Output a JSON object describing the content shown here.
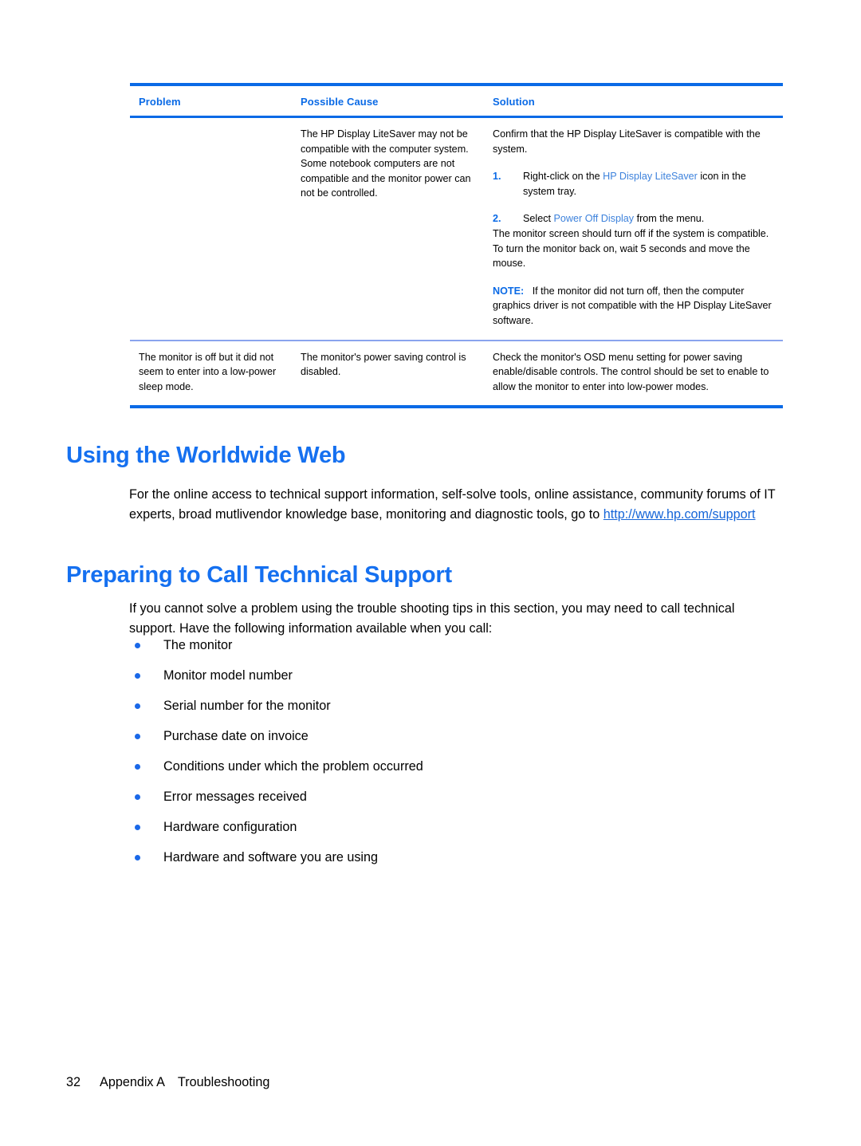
{
  "document": {
    "page_number": "32",
    "appendix": "Appendix A",
    "chapter": "Troubleshooting"
  },
  "colors": {
    "heading_blue": "#1570f0",
    "rule_blue": "#0a6ae6",
    "row_rule_blue": "#8aa4ee",
    "inline_blue": "#3d82dc",
    "link_blue": "#1565d8",
    "bullet_blue": "#1a68e8"
  },
  "table": {
    "headers": {
      "problem": "Problem",
      "possible_cause": "Possible Cause",
      "solution": "Solution"
    },
    "rows": [
      {
        "problem": "",
        "possible_cause": "The HP Display LiteSaver may not be compatible with the computer system. Some notebook computers are not compatible and the monitor power can not be controlled.",
        "solution": {
          "intro": "Confirm that the HP Display LiteSaver is compatible with the system.",
          "steps": [
            {
              "number": "1.",
              "before": "Right-click on the ",
              "highlight": "HP Display LiteSaver",
              "after": " icon in the system tray."
            },
            {
              "number": "2.",
              "before": "Select ",
              "highlight": "Power Off Display",
              "after": " from the menu."
            }
          ],
          "after_steps": "The monitor screen should turn off if the system is compatible. To turn the monitor back on, wait 5 seconds and move the mouse.",
          "note_label": "NOTE:",
          "note_text": "If the monitor did not turn off, then the computer graphics driver is not compatible with the HP Display LiteSaver software."
        }
      },
      {
        "problem": "The monitor is off but it did not seem to enter into a low-power sleep mode.",
        "possible_cause": "The monitor's power saving control is disabled.",
        "solution_text": "Check the monitor's OSD menu setting for power saving enable/disable controls. The control should be set to enable to allow the monitor to enter into low-power modes."
      }
    ]
  },
  "sections": [
    {
      "heading": "Using the Worldwide Web",
      "paragraph_before_link": "For the online access to technical support information, self-solve tools, online assistance, community forums of IT experts, broad mutlivendor knowledge base, monitoring and diagnostic tools, go to ",
      "link_text": "http://www.hp.com/support"
    },
    {
      "heading": "Preparing to Call Technical Support",
      "paragraph": "If you cannot solve a problem using the trouble shooting tips in this section, you may need to call technical support. Have the following information available when you call:"
    }
  ],
  "bullets": [
    "The monitor",
    "Monitor model number",
    "Serial number for the monitor",
    "Purchase date on invoice",
    "Conditions under which the problem occurred",
    "Error messages received",
    "Hardware configuration",
    "Hardware and software you are using"
  ]
}
